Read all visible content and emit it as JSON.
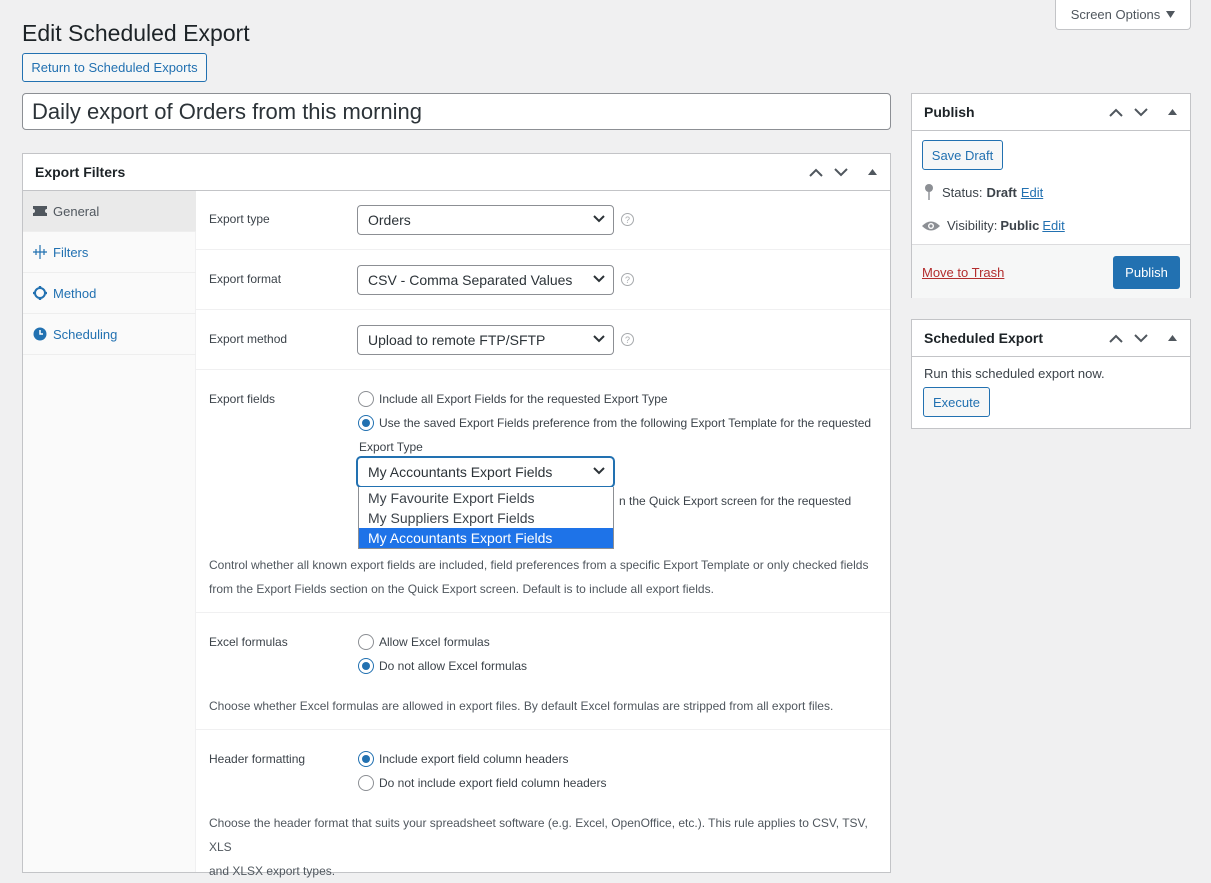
{
  "screen_options": {
    "label": "Screen Options"
  },
  "page": {
    "title": "Edit Scheduled Export",
    "return_button": "Return to Scheduled Exports",
    "export_name": "Daily export of Orders from this morning"
  },
  "export_filters": {
    "title": "Export Filters",
    "tabs": [
      {
        "label": "General",
        "icon": "ticket-icon"
      },
      {
        "label": "Filters",
        "icon": "filter-icon"
      },
      {
        "label": "Method",
        "icon": "gear-icon"
      },
      {
        "label": "Scheduling",
        "icon": "clock-icon"
      }
    ],
    "export_type": {
      "label": "Export type",
      "value": "Orders"
    },
    "export_format": {
      "label": "Export format",
      "value": "CSV - Comma Separated Values"
    },
    "export_method": {
      "label": "Export method",
      "value": "Upload to remote FTP/SFTP"
    },
    "export_fields": {
      "label": "Export fields",
      "option1": "Include all Export Fields for the requested Export Type",
      "option2_line1": "Use the saved Export Fields preference from the following Export Template for the requested",
      "option2_line2": "Export Type",
      "template_value": "My Accountants Export Fields",
      "dropdown_options": [
        "My Favourite Export Fields",
        "My Suppliers Export Fields",
        "My Accountants Export Fields"
      ],
      "option3_partial": "n the Quick Export screen for the requested",
      "desc_line1": "Control whether all known export fields are included, field preferences from a specific Export Template or only checked fields",
      "desc_line2": "from the Export Fields section on the Quick Export screen. Default is to include all export fields."
    },
    "excel_formulas": {
      "label": "Excel formulas",
      "option1": "Allow Excel formulas",
      "option2": "Do not allow Excel formulas",
      "desc": "Choose whether Excel formulas are allowed in export files. By default Excel formulas are stripped from all export files."
    },
    "header_formatting": {
      "label": "Header formatting",
      "option1": "Include export field column headers",
      "option2": "Do not include export field column headers",
      "desc_line1": "Choose the header format that suits your spreadsheet software (e.g. Excel, OpenOffice, etc.). This rule applies to CSV, TSV, XLS",
      "desc_line2": "and XLSX export types."
    }
  },
  "publish": {
    "title": "Publish",
    "save_draft": "Save Draft",
    "status_label": "Status:",
    "status_value": "Draft",
    "visibility_label": "Visibility:",
    "visibility_value": "Public",
    "edit_link": "Edit",
    "trash_link": "Move to Trash",
    "publish_button": "Publish"
  },
  "scheduled_export": {
    "title": "Scheduled Export",
    "text": "Run this scheduled export now.",
    "execute": "Execute"
  },
  "colors": {
    "accent": "#2271b1",
    "trash": "#b32d2e",
    "selected_option": "#1e73e8"
  }
}
